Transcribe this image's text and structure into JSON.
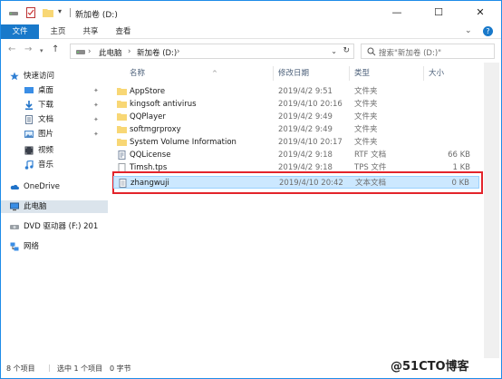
{
  "window": {
    "title": "新加卷 (D:)",
    "minimize_icon": "minimize-icon",
    "maximize_icon": "maximize-icon",
    "close_icon": "close-icon"
  },
  "ribbon": {
    "tabs": [
      "文件",
      "主页",
      "共享",
      "查看"
    ]
  },
  "nav": {
    "back_icon": "arrow-left-icon",
    "forward_icon": "arrow-right-icon",
    "up_icon": "arrow-up-icon",
    "breadcrumb": [
      "此电脑",
      "新加卷 (D:)"
    ],
    "search_placeholder": "搜索\"新加卷 (D:)\""
  },
  "sidebar": {
    "items": [
      {
        "label": "快速访问",
        "icon": "star-icon",
        "pinned": false
      },
      {
        "label": "桌面",
        "icon": "desktop-icon",
        "pinned": true
      },
      {
        "label": "下载",
        "icon": "download-icon",
        "pinned": true
      },
      {
        "label": "文档",
        "icon": "document-icon",
        "pinned": true
      },
      {
        "label": "图片",
        "icon": "picture-icon",
        "pinned": true
      },
      {
        "label": "视频",
        "icon": "video-icon",
        "pinned": false
      },
      {
        "label": "音乐",
        "icon": "music-icon",
        "pinned": false
      },
      {
        "label": "OneDrive",
        "icon": "cloud-icon",
        "pinned": false
      },
      {
        "label": "此电脑",
        "icon": "computer-icon",
        "pinned": false
      },
      {
        "label": "DVD 驱动器 (F:) 201",
        "icon": "dvd-icon",
        "pinned": false
      },
      {
        "label": "网络",
        "icon": "network-icon",
        "pinned": false
      }
    ]
  },
  "columns": {
    "name": "名称",
    "date": "修改日期",
    "type": "类型",
    "size": "大小"
  },
  "files": [
    {
      "name": "AppStore",
      "date": "2019/4/2 9:51",
      "type": "文件夹",
      "size": "",
      "icon": "folder-icon"
    },
    {
      "name": "kingsoft antivirus",
      "date": "2019/4/10 20:16",
      "type": "文件夹",
      "size": "",
      "icon": "folder-icon"
    },
    {
      "name": "QQPlayer",
      "date": "2019/4/2 9:49",
      "type": "文件夹",
      "size": "",
      "icon": "folder-icon"
    },
    {
      "name": "softmgrproxy",
      "date": "2019/4/2 9:49",
      "type": "文件夹",
      "size": "",
      "icon": "folder-icon"
    },
    {
      "name": "System Volume Information",
      "date": "2019/4/10 20:17",
      "type": "文件夹",
      "size": "",
      "icon": "folder-icon"
    },
    {
      "name": "QQLicense",
      "date": "2019/4/2 9:18",
      "type": "RTF 文档",
      "size": "66 KB",
      "icon": "rtf-file-icon"
    },
    {
      "name": "Timsh.tps",
      "date": "2019/4/2 9:18",
      "type": "TPS 文件",
      "size": "1 KB",
      "icon": "file-icon"
    },
    {
      "name": "zhangwuji",
      "date": "2019/4/10 20:42",
      "type": "文本文档",
      "size": "0 KB",
      "icon": "text-file-icon",
      "selected": true
    }
  ],
  "status": {
    "count": "8 个项目",
    "selected": "选中 1 个项目",
    "size": "0 字节"
  },
  "watermark": "@51CTO博客",
  "colors": {
    "accent": "#1979ca",
    "selection": "#cce8ff",
    "highlight_box": "#e3242b",
    "folder": "#f8d775"
  }
}
